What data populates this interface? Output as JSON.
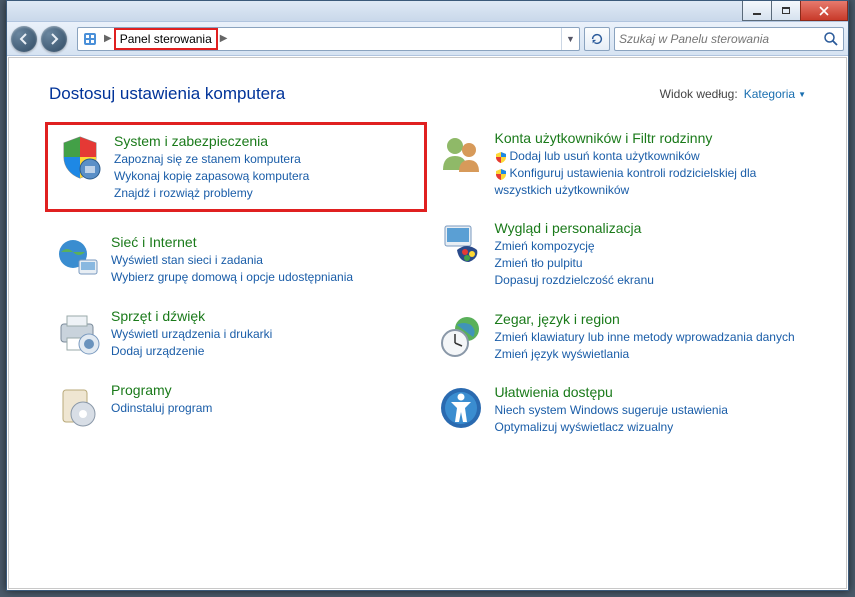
{
  "breadcrumb": {
    "location": "Panel sterowania"
  },
  "search": {
    "placeholder": "Szukaj w Panelu sterowania"
  },
  "heading": "Dostosuj ustawienia komputera",
  "viewBy": {
    "label": "Widok według:",
    "value": "Kategoria"
  },
  "left": [
    {
      "title": "System i zabezpieczenia",
      "links": [
        "Zapoznaj się ze stanem komputera",
        "Wykonaj kopię zapasową komputera",
        "Znajdź i rozwiąż problemy"
      ]
    },
    {
      "title": "Sieć i Internet",
      "links": [
        "Wyświetl stan sieci i zadania",
        "Wybierz grupę domową i opcje udostępniania"
      ]
    },
    {
      "title": "Sprzęt i dźwięk",
      "links": [
        "Wyświetl urządzenia i drukarki",
        "Dodaj urządzenie"
      ]
    },
    {
      "title": "Programy",
      "links": [
        "Odinstaluj program"
      ]
    }
  ],
  "right": [
    {
      "title": "Konta użytkowników i Filtr rodzinny",
      "links": [
        "Dodaj lub usuń konta użytkowników",
        "Konfiguruj ustawienia kontroli rodzicielskiej dla wszystkich użytkowników"
      ],
      "shields": [
        true,
        true
      ]
    },
    {
      "title": "Wygląd i personalizacja",
      "links": [
        "Zmień kompozycję",
        "Zmień tło pulpitu",
        "Dopasuj rozdzielczość ekranu"
      ]
    },
    {
      "title": "Zegar, język i region",
      "links": [
        "Zmień klawiatury lub inne metody wprowadzania danych",
        "Zmień język wyświetlania"
      ]
    },
    {
      "title": "Ułatwienia dostępu",
      "links": [
        "Niech system Windows sugeruje ustawienia",
        "Optymalizuj wyświetlacz wizualny"
      ]
    }
  ]
}
